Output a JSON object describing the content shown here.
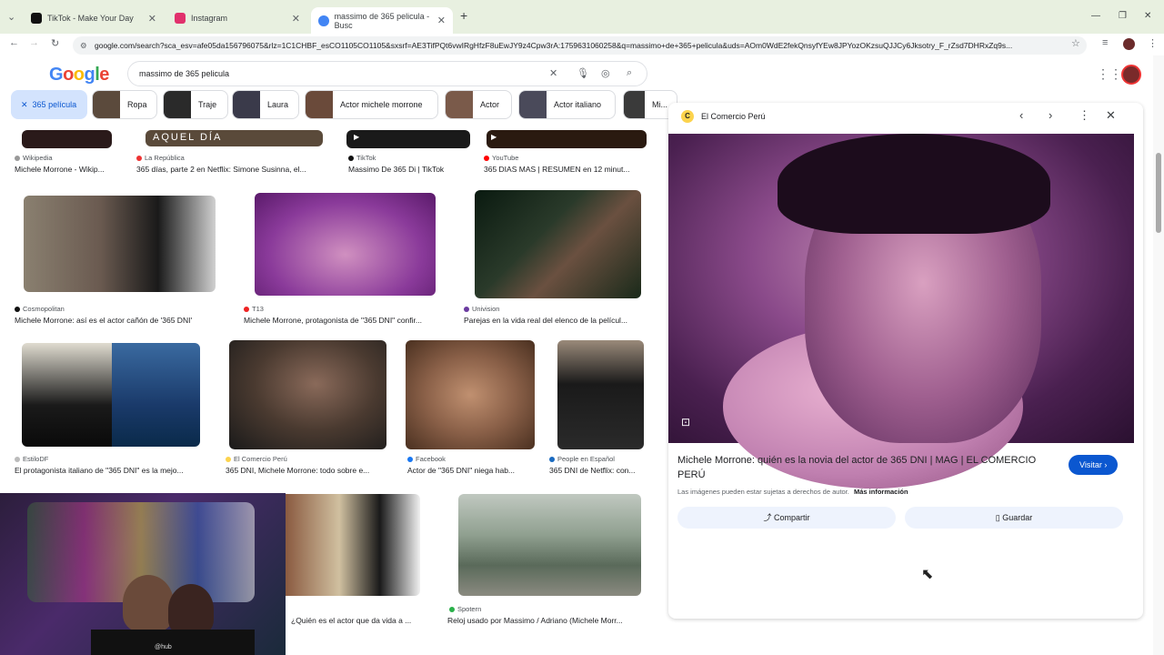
{
  "browser": {
    "tabs": [
      {
        "title": "TikTok - Make Your Day",
        "color": "#111111"
      },
      {
        "title": "Instagram",
        "color": "#e1306c"
      },
      {
        "title": "massimo de 365 pelicula - Busc",
        "color": "#4285f4"
      }
    ],
    "new_tab": "+",
    "url": "google.com/search?sca_esv=afe05da156796075&rlz=1C1CHBF_esCO1105CO1105&sxsrf=AE3TifPQt6vwIRgHfzF8uEwJY9z4Cpw3rA:1759631060258&q=massimo+de+365+pelicula&uds=AOm0WdE2fekQnsyfYEw8JPYozOKzsuQJJCy6Jksotry_F_rZsd7DHRxZq9s..."
  },
  "google": {
    "logo": "Google",
    "query": "massimo de 365 pelicula",
    "chips": [
      {
        "label": "365 película",
        "selected": true
      },
      {
        "label": "Ropa"
      },
      {
        "label": "Traje"
      },
      {
        "label": "Laura"
      },
      {
        "label": "Actor michele morrone"
      },
      {
        "label": "Actor"
      },
      {
        "label": "Actor italiano"
      },
      {
        "label": "Mi..."
      }
    ]
  },
  "results": {
    "row1": [
      {
        "source": "Wikipedia",
        "title": "Michele Morrone - Wikip..."
      },
      {
        "source": "La República",
        "title": "365 días, parte 2 en Netflix: Simone Susinna, el..."
      },
      {
        "source": "TikTok",
        "title": "Massimo De 365 Di | TikTok"
      },
      {
        "source": "YouTube",
        "title": "365 DIAS MAS | RESUMEN en 12 minut..."
      }
    ],
    "row1_overlay": "AQUEL DÍA",
    "row2": [
      {
        "source": "Cosmopolitan",
        "title": "Michele Morrone: así es el actor cañón de '365 DNI'"
      },
      {
        "source": "T13",
        "title": "Michele Morrone, protagonista de \"365 DNI\" confir..."
      },
      {
        "source": "Univision",
        "title": "Parejas en la vida real del elenco de la películ..."
      }
    ],
    "row3": [
      {
        "source": "EstiloDF",
        "title": "El protagonista italiano de \"365 DNI\" es la mejo..."
      },
      {
        "source": "El Comercio Perú",
        "title": "365 DNI, Michele Morrone: todo sobre e..."
      },
      {
        "source": "Facebook",
        "title": "Actor de \"365 DNI\" niega hab..."
      },
      {
        "source": "People en Español",
        "title": "365 DNI de Netflix: con..."
      }
    ],
    "row4": [
      {
        "source": "",
        "title": "¿Quién es el actor que da vida a ..."
      },
      {
        "source": "Spotern",
        "title": "Reloj usado por Massimo / Adriano (Michele Morr..."
      }
    ]
  },
  "panel": {
    "source": "El Comercio Perú",
    "title": "Michele Morrone: quién es la novia del actor de 365 DNI | MAG | EL COMERCIO PERÚ",
    "visit_label": "Visitar",
    "rights": "Las imágenes pueden estar sujetas a derechos de autor.",
    "more_info": "Más información",
    "share_label": "Compartir",
    "save_label": "Guardar"
  },
  "webcam": {
    "tag": "@hub"
  },
  "colors": {
    "accent": "#0b57d0",
    "chip_selected_bg": "#d3e3fd",
    "tabbar_bg": "#e8f0e0"
  }
}
